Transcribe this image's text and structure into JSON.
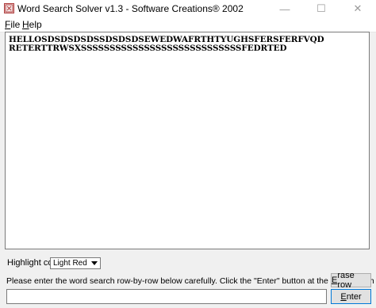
{
  "window": {
    "title": "Word Search Solver v1.3 - Software Creations® 2002",
    "icon": "word-search-app-icon",
    "controls": {
      "minimize": "—",
      "maximize": "☐",
      "close": "✕"
    }
  },
  "menu": {
    "file": {
      "accel": "F",
      "rest": "ile"
    },
    "help": {
      "accel": "H",
      "rest": "elp"
    }
  },
  "grid": {
    "rows": [
      "HELLOSDSDSDSDSSDSDSDSEWEDWAFRTHTYUGHSFERSFERFVQD",
      "RETERTTRWSXSSSSSSSSSSSSSSSSSSSSSSSSSSSSFEDRTED"
    ]
  },
  "highlight": {
    "label": "Highlight color:",
    "selected": "Light Red"
  },
  "instructions": "Please enter the word search row-by-row below carefully. Click the \"Enter\" button at the end of each row.",
  "buttons": {
    "erase_row": {
      "accel": "E",
      "rest": "rase row"
    },
    "enter": {
      "accel": "E",
      "rest": "nter"
    }
  },
  "entry": {
    "value": ""
  }
}
